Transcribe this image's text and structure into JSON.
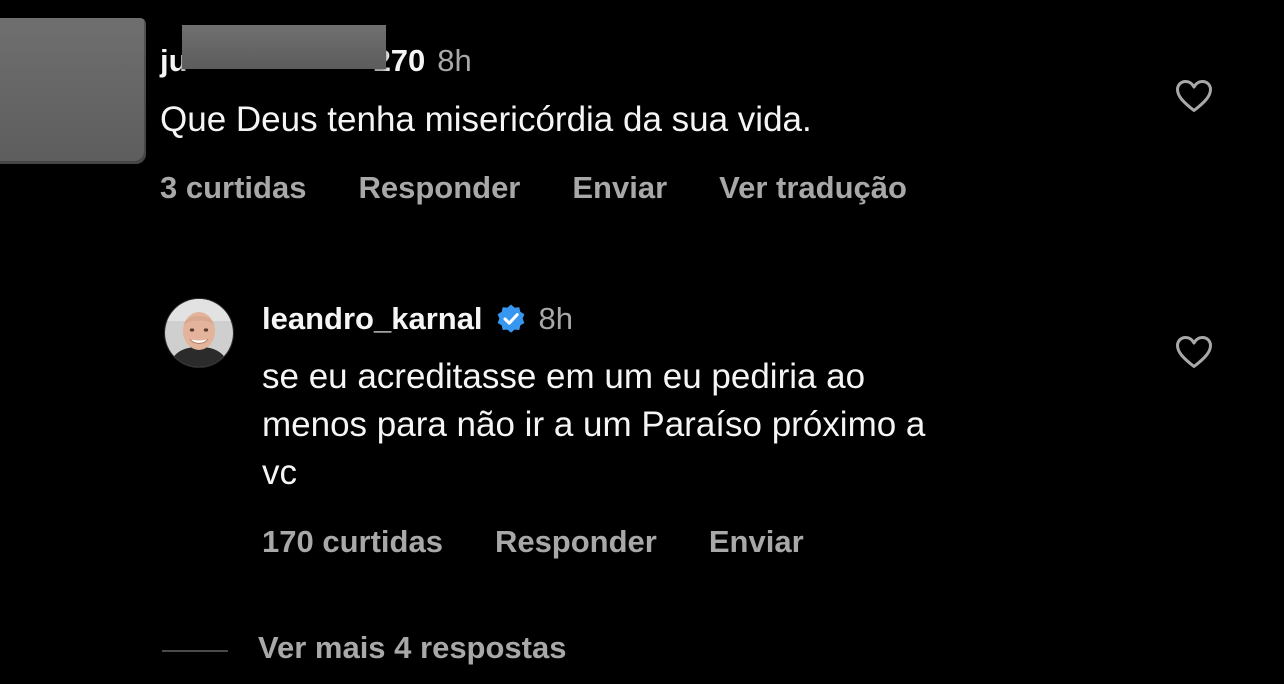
{
  "comment": {
    "username_start": "ju",
    "username_end": "270",
    "timestamp": "8h",
    "text": "Que Deus tenha misericórdia da sua vida.",
    "likes": "3 curtidas",
    "reply_label": "Responder",
    "send_label": "Enviar",
    "translate_label": "Ver tradução",
    "like_icon": "heart-outline-icon"
  },
  "reply": {
    "username": "leandro_karnal",
    "verified_icon": "verified-badge-icon",
    "verified_color": "#3797f0",
    "timestamp": "8h",
    "text": "se eu acreditasse em um eu pediria ao\nmenos para não ir a um Paraíso próximo a\nvc",
    "likes": "170 curtidas",
    "reply_label": "Responder",
    "send_label": "Enviar",
    "like_icon": "heart-outline-icon"
  },
  "view_more": {
    "label": "Ver mais 4 respostas"
  },
  "colors": {
    "background": "#000000",
    "primary_text": "#f5f5f5",
    "secondary_text": "#a8a8a8"
  }
}
